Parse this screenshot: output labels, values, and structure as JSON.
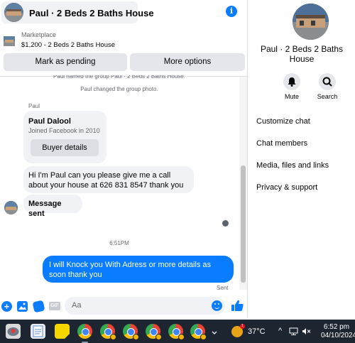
{
  "header": {
    "title": "Paul · 2 Beds 2 Baths House",
    "info_icon": "i"
  },
  "marketplace": {
    "label": "Marketplace",
    "listing": "$1,200 - 2 Beds 2 Baths House",
    "mark_pending": "Mark as pending",
    "more_options": "More options"
  },
  "chat": {
    "system_cutoff": "Paul named the group Paul · 2 Beds 2 Baths House.",
    "system_photo": "Paul changed the group photo.",
    "sender_name": "Paul",
    "card": {
      "name": "Paul Dalool",
      "subtitle": "Joined Facebook in 2010",
      "button": "Buyer details"
    },
    "message_1": "Hi I'm Paul can you please give me a call about your house at 626 831 8547 thank you",
    "message_2": "Message sent",
    "timestamp": "6:51PM",
    "outgoing": "I will Knock you With Adress or more details  as soon thank you",
    "status": "Sent"
  },
  "composer": {
    "placeholder": "Aa",
    "gif_label": "GIF",
    "plus_glyph": "+"
  },
  "info_panel": {
    "name": "Paul · 2 Beds 2 Baths House",
    "mute_label": "Mute",
    "search_label": "Search",
    "menu": [
      "Customize chat",
      "Chat members",
      "Media, files and links",
      "Privacy & support"
    ]
  },
  "taskbar": {
    "temperature": "37°C",
    "time": "6:52 pm",
    "date": "04/10/2024",
    "weather_badge": "1",
    "chevron": "^",
    "apps": [
      "app-icon",
      "notepad-icon",
      "sticky-notes-icon",
      "chrome-icon",
      "chrome-icon",
      "chrome-icon",
      "chrome-icon",
      "chrome-icon",
      "chrome-icon"
    ]
  },
  "colors": {
    "messenger_blue": "#0a7cff",
    "bubble_gray": "#f0f2f5",
    "taskbar": "#1c2530"
  }
}
